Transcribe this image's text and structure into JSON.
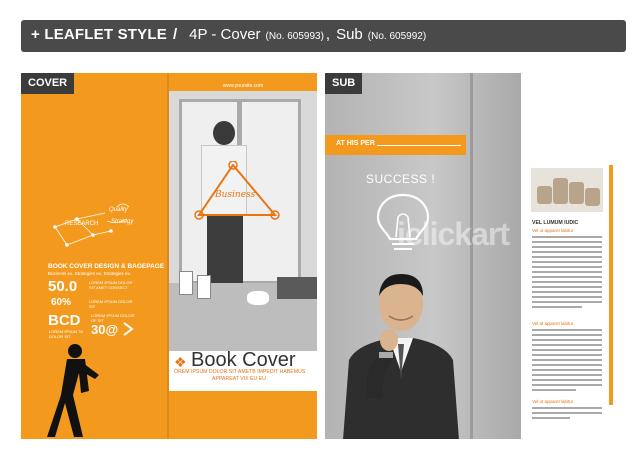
{
  "header": {
    "prefix": "+ LEAFLET STYLE",
    "separator": "/",
    "cover_label": "4P - Cover",
    "cover_no": "(No. 605993)",
    "comma": ",",
    "sub_label": "Sub",
    "sub_no": "(No. 605992)"
  },
  "cover": {
    "tag": "COVER",
    "site": "www.yoursite.com",
    "research": "RESEARCH",
    "quality": "Quality",
    "strategy": "Strategy",
    "business": "Business",
    "design_title": "BOOK COVER DESIGN & BAGEPAGE",
    "design_sub": "Business ex. Strategies ex. Strategies ex.",
    "stat1": "50.0",
    "stat1_note": "LOREM IPSUM DOLOR SIT AMET CONSECT",
    "stat2": "60%",
    "stat2_note": "LOREM IPSUM DOLOR SIT",
    "stat3": "BCD",
    "stat3_note": "LOREM IPSUM TA DOLOR SIT",
    "stat4": "30@",
    "stat4_note": "LOREM IPSUM DOLOR OF SIT",
    "book_title": "Book Cover",
    "book_sub1": "OREM IPSUM DOLOR SIT AMETB IMPEDIT HABEMUS",
    "book_sub2": "APPAREAT VIX EU EU"
  },
  "sub": {
    "tag": "SUB",
    "ribbon": "AT HIS PER",
    "success": "SUCCESS !",
    "watermark": "iclickart",
    "vel": "VEL LUMUM IUDIC",
    "subhead1": "Vel ut apparet labitur",
    "subhead2": "Vel at apparet labitur",
    "subhead3": "Vel ut apparet labitur"
  },
  "colors": {
    "orange": "#f39a1e",
    "dark": "#3b3b3b",
    "header": "#4a4a4a"
  }
}
